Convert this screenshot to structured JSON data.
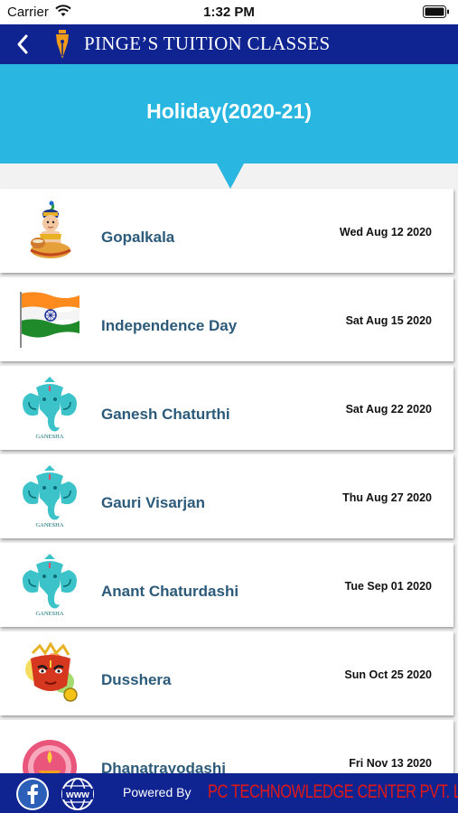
{
  "status_bar": {
    "carrier": "Carrier",
    "time": "1:32 PM",
    "icons": [
      "wifi-icon",
      "battery-icon"
    ]
  },
  "nav": {
    "back_icon": "chevron-left-icon",
    "logo_icon": "pen-nib-logo-icon",
    "title": "PINGE’S TUITION CLASSES"
  },
  "banner": {
    "title": "Holiday(2020-21)"
  },
  "holidays": [
    {
      "name": "Gopalkala",
      "date": "Wed Aug 12 2020",
      "icon": "krishna-icon"
    },
    {
      "name": "Independence Day",
      "date": "Sat Aug 15 2020",
      "icon": "indian-flag-icon"
    },
    {
      "name": "Ganesh Chaturthi",
      "date": "Sat Aug 22 2020",
      "icon": "ganesha-icon",
      "icon_caption": "GANESHA"
    },
    {
      "name": "Gauri Visarjan",
      "date": "Thu Aug 27 2020",
      "icon": "ganesha-icon",
      "icon_caption": "GANESHA"
    },
    {
      "name": "Anant Chaturdashi",
      "date": "Tue Sep 01 2020",
      "icon": "ganesha-icon",
      "icon_caption": "GANESHA"
    },
    {
      "name": "Dusshera",
      "date": "Sun Oct 25 2020",
      "icon": "durga-icon"
    },
    {
      "name": "Dhanatrayodashi",
      "date": "Fri Nov 13 2020",
      "icon": "diya-icon"
    }
  ],
  "footer": {
    "facebook_icon": "facebook-icon",
    "web_icon": "www-globe-icon",
    "powered_by": "Powered By",
    "company": "PC TECHNOWLEDGE CENTER PVT. LTD"
  },
  "colors": {
    "nav_bg": "#0f2490",
    "banner_bg": "#29b6e0",
    "item_text": "#2c5a7a",
    "company_text": "#e01818",
    "flag_saffron": "#ff8a1e",
    "flag_green": "#1e8a2a",
    "ganesha_teal": "#3cc3c9"
  }
}
